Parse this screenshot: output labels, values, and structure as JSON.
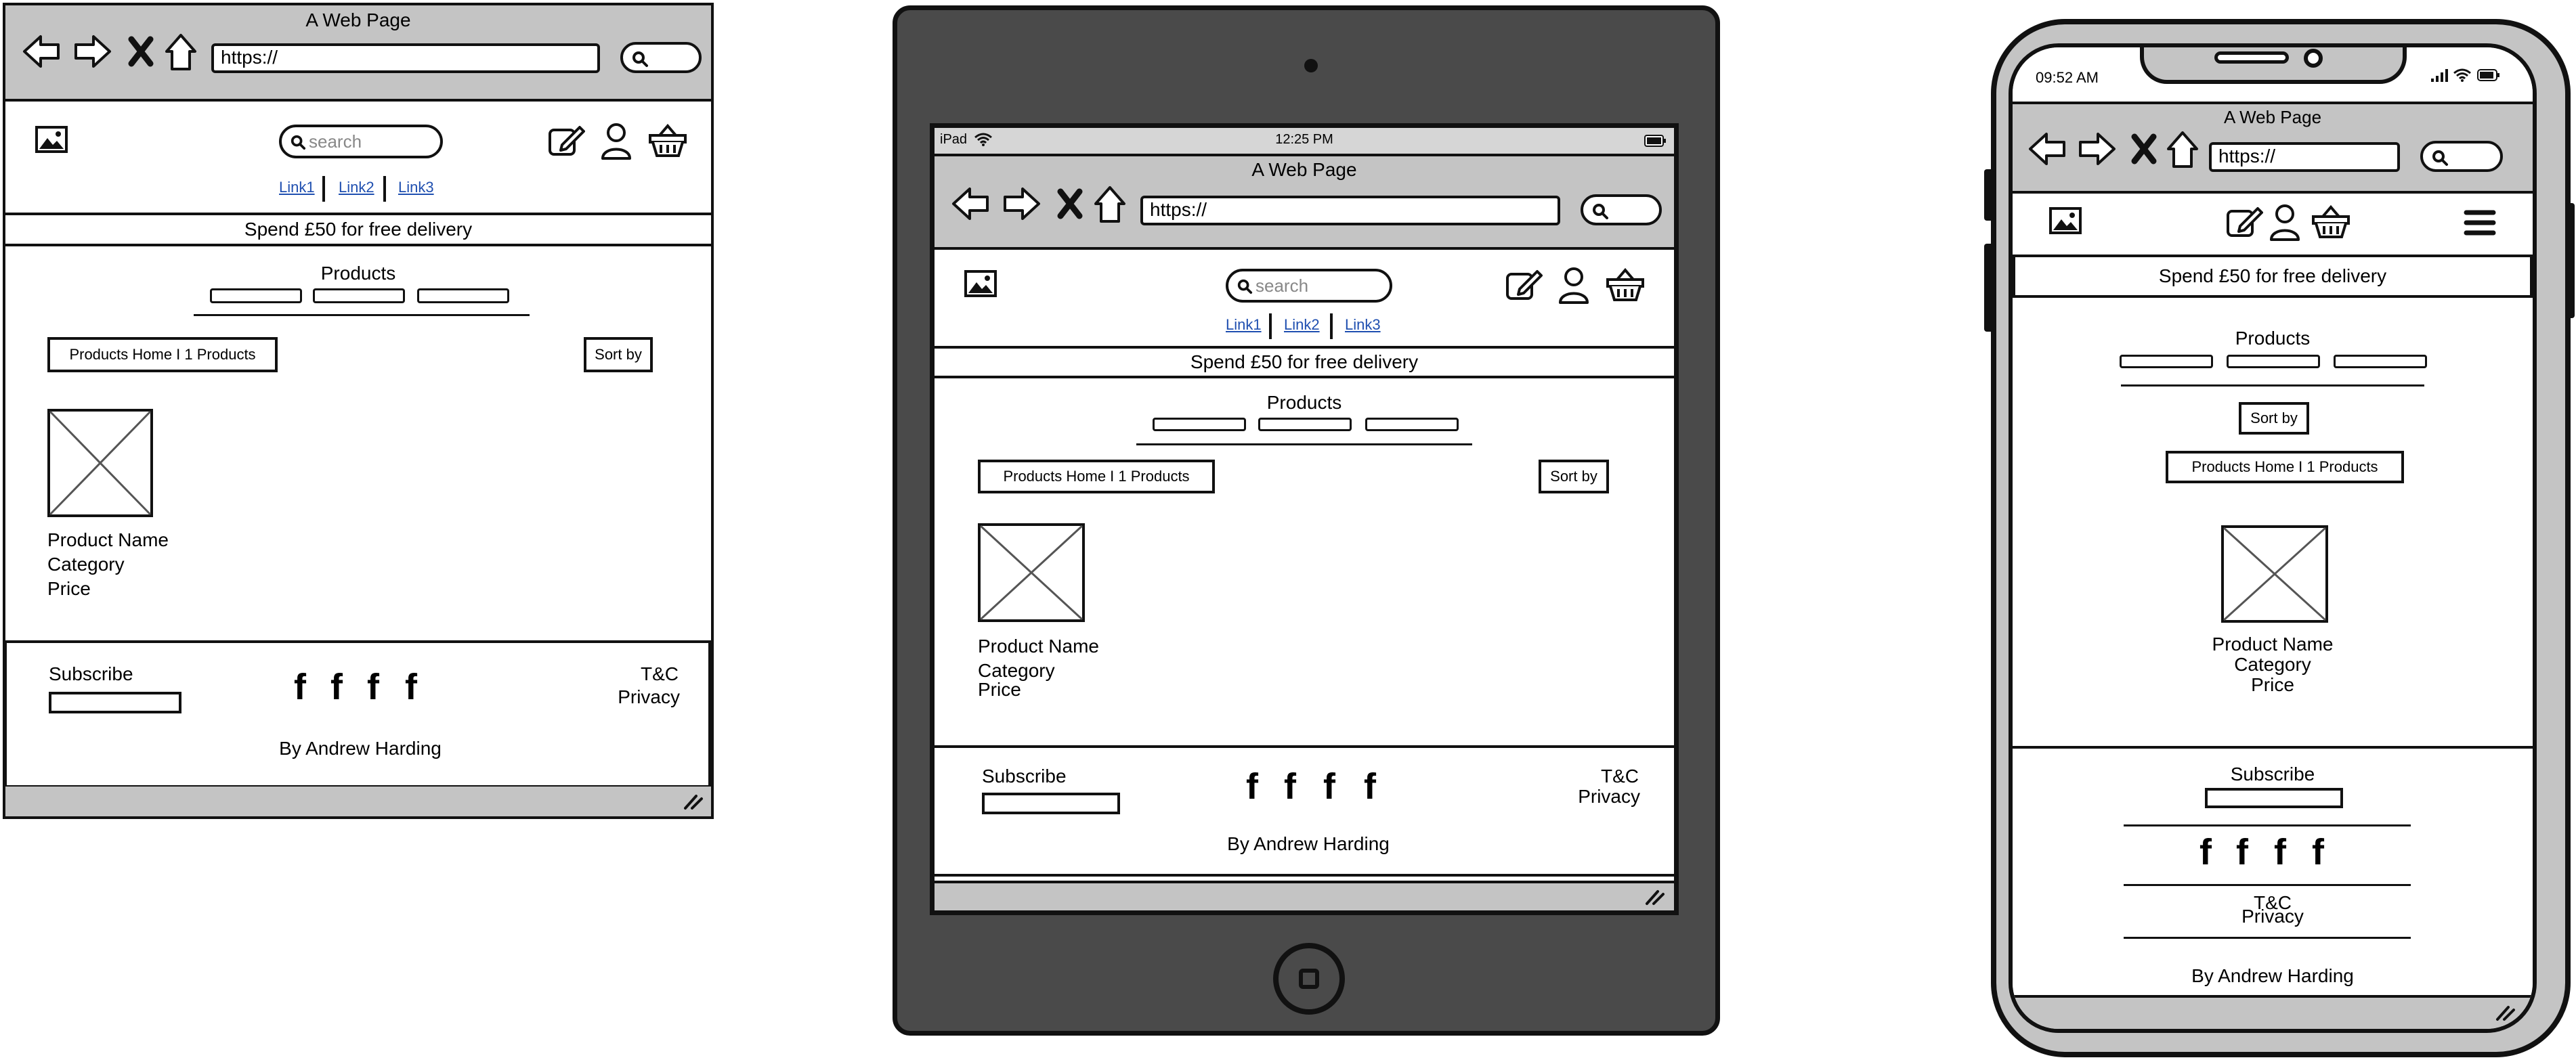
{
  "browser": {
    "title": "A Web Page",
    "url": "https://"
  },
  "header": {
    "search_placeholder": "search",
    "nav_links": [
      "Link1",
      "Link2",
      "Link3"
    ]
  },
  "banner": {
    "text": "Spend £50 for free delivery"
  },
  "products": {
    "heading": "Products",
    "breadcrumb": "Products Home I 1 Products",
    "sort_label": "Sort by",
    "item": {
      "name": "Product Name",
      "category": "Category",
      "price": "Price"
    }
  },
  "footer": {
    "subscribe": "Subscribe",
    "social_icons": [
      "f",
      "f",
      "f",
      "f"
    ],
    "tc": "T&C",
    "privacy": "Privacy",
    "credit": "By Andrew Harding"
  },
  "tablet": {
    "carrier": "iPad",
    "time": "12:25 PM"
  },
  "phone": {
    "time": "09:52 AM"
  }
}
